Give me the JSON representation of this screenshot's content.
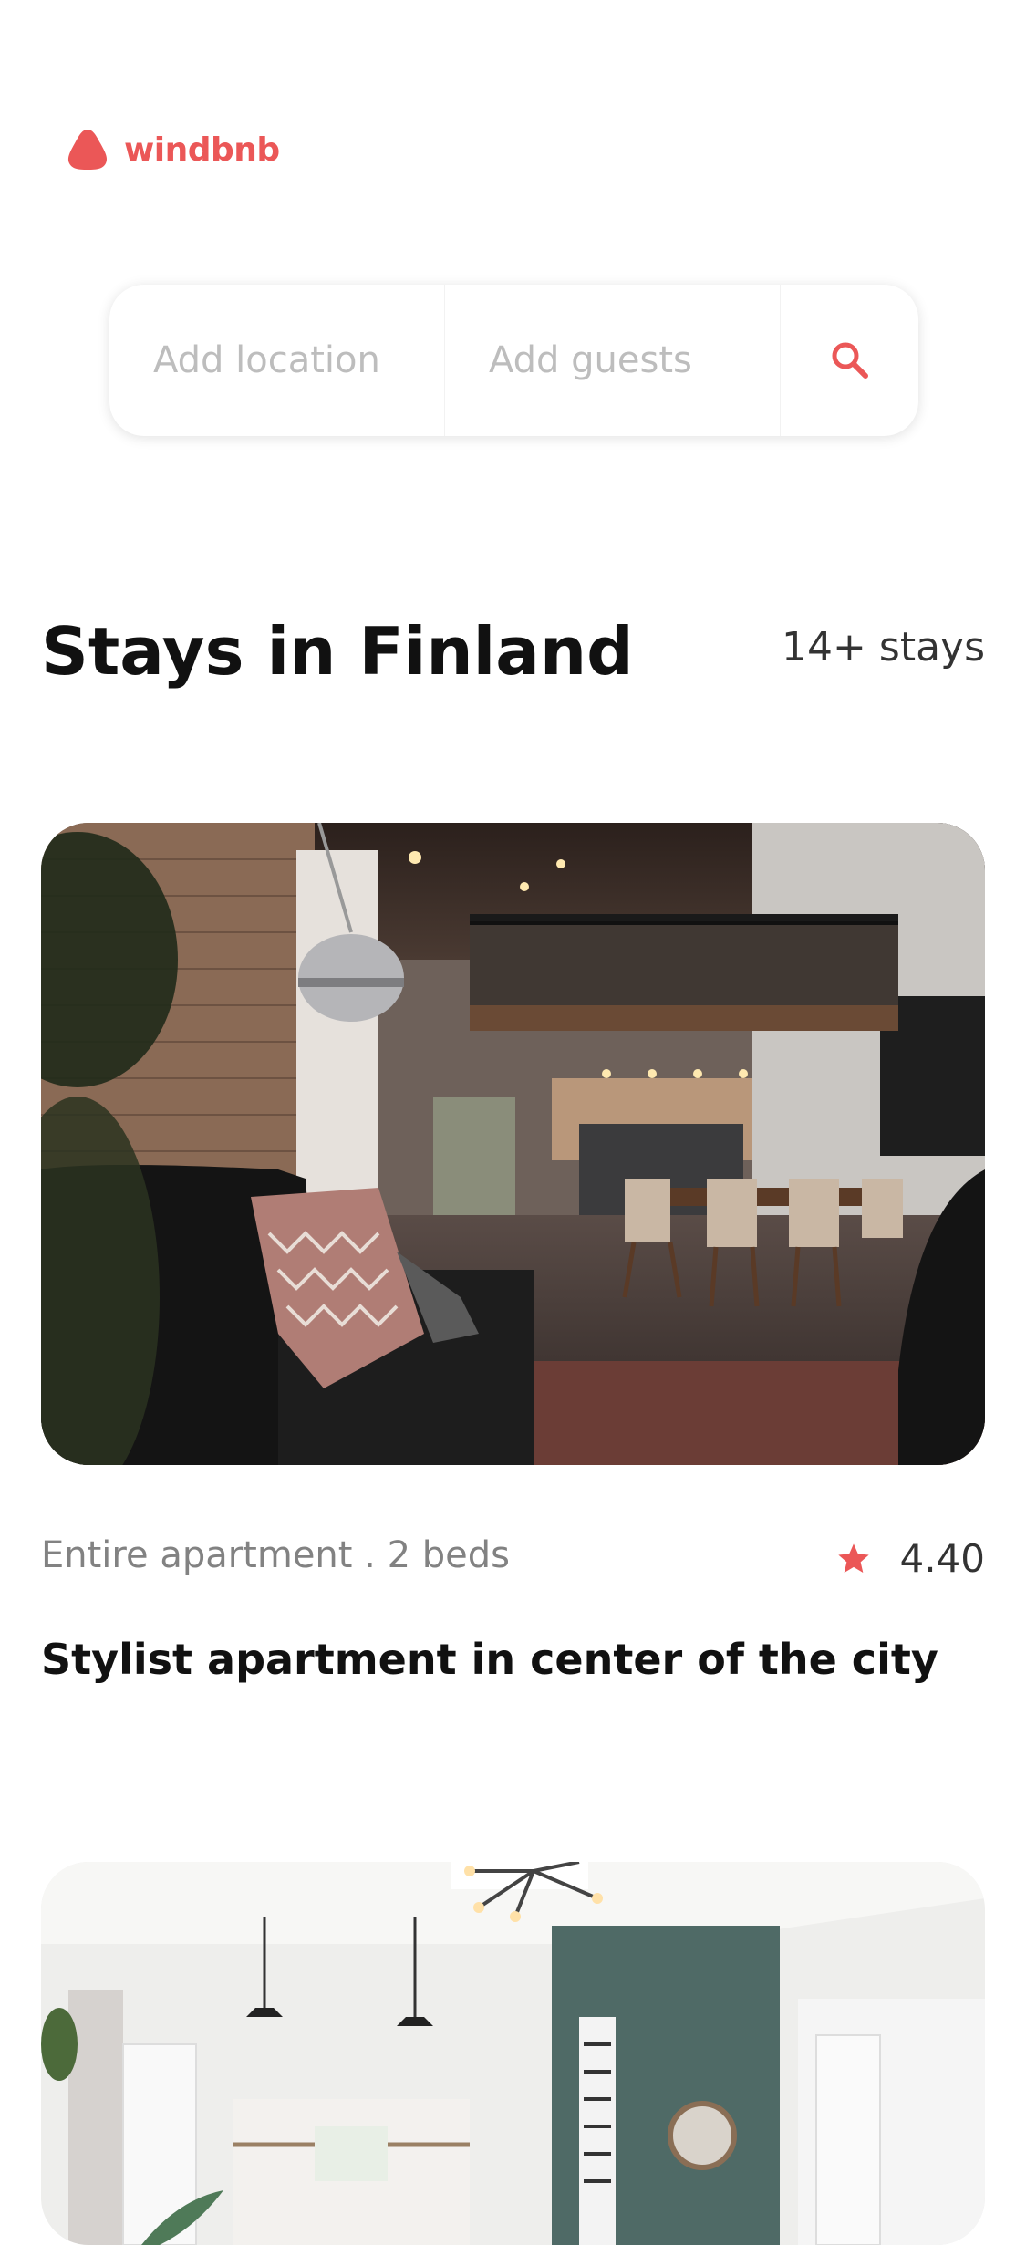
{
  "brand": {
    "name": "windbnb",
    "color": "#EB5757"
  },
  "search": {
    "location_placeholder": "Add location",
    "guests_placeholder": "Add guests",
    "icon": "search-icon"
  },
  "section": {
    "title": "Stays in Finland",
    "count": "14+ stays"
  },
  "stays": [
    {
      "type": "Entire apartment . 2 beds",
      "rating": "4.40",
      "title": "Stylist apartment in center of the city",
      "rating_icon": "star-icon"
    },
    {
      "type": "",
      "rating": "",
      "title": ""
    }
  ]
}
